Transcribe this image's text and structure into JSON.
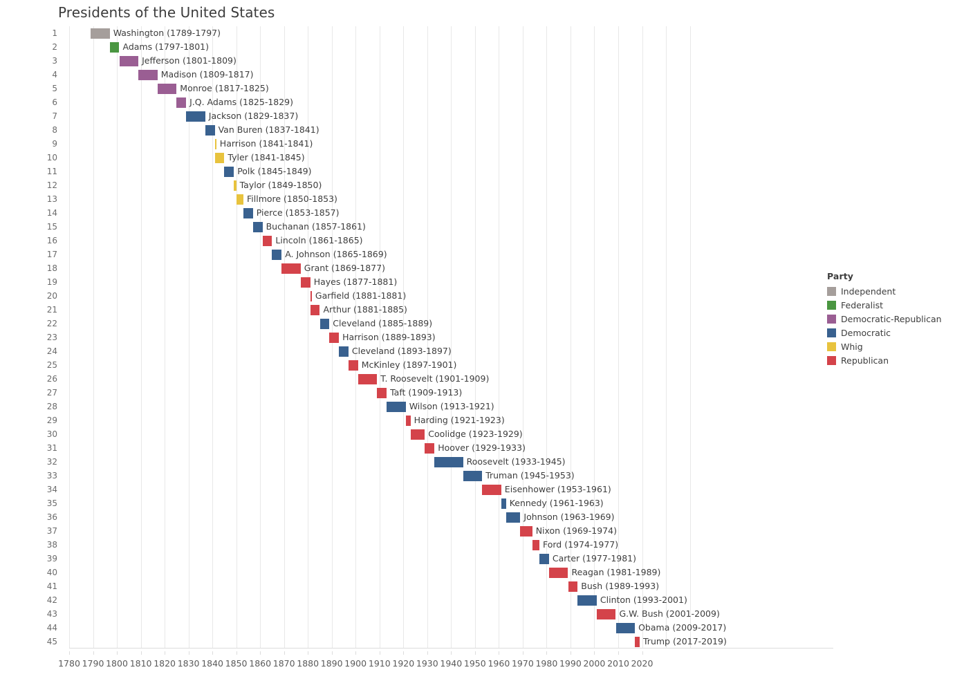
{
  "chart_data": {
    "type": "bar",
    "title": "Presidents of the United States",
    "subtitle": "",
    "xlabel": "",
    "ylabel": "",
    "orientation": "horizontal",
    "grid": true,
    "legend_position": "right",
    "xlim": [
      1780,
      2020
    ],
    "x_ticks": [
      1780,
      1790,
      1800,
      1810,
      1820,
      1830,
      1840,
      1850,
      1860,
      1870,
      1880,
      1890,
      1900,
      1910,
      1920,
      1930,
      1940,
      1950,
      1960,
      1970,
      1980,
      1990,
      2000,
      2010,
      2020
    ],
    "y_ticks": [
      1,
      2,
      3,
      4,
      5,
      6,
      7,
      8,
      9,
      10,
      11,
      12,
      13,
      14,
      15,
      16,
      17,
      18,
      19,
      20,
      21,
      22,
      23,
      24,
      25,
      26,
      27,
      28,
      29,
      30,
      31,
      32,
      33,
      34,
      35,
      36,
      37,
      38,
      39,
      40,
      41,
      42,
      43,
      44,
      45
    ],
    "legend": {
      "title": "Party",
      "entries": [
        {
          "label": "Independent",
          "color": "#a59e9b"
        },
        {
          "label": "Federalist",
          "color": "#4a9641"
        },
        {
          "label": "Democratic-Republican",
          "color": "#9a5e93"
        },
        {
          "label": "Democratic",
          "color": "#39618f"
        },
        {
          "label": "Whig",
          "color": "#e8c33e"
        },
        {
          "label": "Republican",
          "color": "#d4434a"
        }
      ]
    },
    "party_colors": {
      "Independent": "#a59e9b",
      "Federalist": "#4a9641",
      "Democratic-Republican": "#9a5e93",
      "Democratic": "#39618f",
      "Whig": "#e8c33e",
      "Republican": "#d4434a"
    },
    "bars": [
      {
        "num": 1,
        "name": "Washington",
        "start": 1789,
        "end": 1797,
        "party": "Independent",
        "label": "Washington (1789-1797)"
      },
      {
        "num": 2,
        "name": "Adams",
        "start": 1797,
        "end": 1801,
        "party": "Federalist",
        "label": "Adams (1797-1801)"
      },
      {
        "num": 3,
        "name": "Jefferson",
        "start": 1801,
        "end": 1809,
        "party": "Democratic-Republican",
        "label": "Jefferson (1801-1809)"
      },
      {
        "num": 4,
        "name": "Madison",
        "start": 1809,
        "end": 1817,
        "party": "Democratic-Republican",
        "label": "Madison (1809-1817)"
      },
      {
        "num": 5,
        "name": "Monroe",
        "start": 1817,
        "end": 1825,
        "party": "Democratic-Republican",
        "label": "Monroe (1817-1825)"
      },
      {
        "num": 6,
        "name": "J.Q. Adams",
        "start": 1825,
        "end": 1829,
        "party": "Democratic-Republican",
        "label": "J.Q. Adams (1825-1829)"
      },
      {
        "num": 7,
        "name": "Jackson",
        "start": 1829,
        "end": 1837,
        "party": "Democratic",
        "label": "Jackson (1829-1837)"
      },
      {
        "num": 8,
        "name": "Van Buren",
        "start": 1837,
        "end": 1841,
        "party": "Democratic",
        "label": "Van Buren (1837-1841)"
      },
      {
        "num": 9,
        "name": "Harrison",
        "start": 1841,
        "end": 1841,
        "party": "Whig",
        "label": "Harrison (1841-1841)"
      },
      {
        "num": 10,
        "name": "Tyler",
        "start": 1841,
        "end": 1845,
        "party": "Whig",
        "label": "Tyler (1841-1845)"
      },
      {
        "num": 11,
        "name": "Polk",
        "start": 1845,
        "end": 1849,
        "party": "Democratic",
        "label": "Polk (1845-1849)"
      },
      {
        "num": 12,
        "name": "Taylor",
        "start": 1849,
        "end": 1850,
        "party": "Whig",
        "label": "Taylor (1849-1850)"
      },
      {
        "num": 13,
        "name": "Fillmore",
        "start": 1850,
        "end": 1853,
        "party": "Whig",
        "label": "Fillmore (1850-1853)"
      },
      {
        "num": 14,
        "name": "Pierce",
        "start": 1853,
        "end": 1857,
        "party": "Democratic",
        "label": "Pierce (1853-1857)"
      },
      {
        "num": 15,
        "name": "Buchanan",
        "start": 1857,
        "end": 1861,
        "party": "Democratic",
        "label": "Buchanan (1857-1861)"
      },
      {
        "num": 16,
        "name": "Lincoln",
        "start": 1861,
        "end": 1865,
        "party": "Republican",
        "label": "Lincoln (1861-1865)"
      },
      {
        "num": 17,
        "name": "A. Johnson",
        "start": 1865,
        "end": 1869,
        "party": "Democratic",
        "label": "A. Johnson (1865-1869)"
      },
      {
        "num": 18,
        "name": "Grant",
        "start": 1869,
        "end": 1877,
        "party": "Republican",
        "label": "Grant (1869-1877)"
      },
      {
        "num": 19,
        "name": "Hayes",
        "start": 1877,
        "end": 1881,
        "party": "Republican",
        "label": "Hayes (1877-1881)"
      },
      {
        "num": 20,
        "name": "Garfield",
        "start": 1881,
        "end": 1881,
        "party": "Republican",
        "label": "Garfield (1881-1881)"
      },
      {
        "num": 21,
        "name": "Arthur",
        "start": 1881,
        "end": 1885,
        "party": "Republican",
        "label": "Arthur (1881-1885)"
      },
      {
        "num": 22,
        "name": "Cleveland",
        "start": 1885,
        "end": 1889,
        "party": "Democratic",
        "label": "Cleveland (1885-1889)"
      },
      {
        "num": 23,
        "name": "Harrison",
        "start": 1889,
        "end": 1893,
        "party": "Republican",
        "label": "Harrison (1889-1893)"
      },
      {
        "num": 24,
        "name": "Cleveland",
        "start": 1893,
        "end": 1897,
        "party": "Democratic",
        "label": "Cleveland (1893-1897)"
      },
      {
        "num": 25,
        "name": "McKinley",
        "start": 1897,
        "end": 1901,
        "party": "Republican",
        "label": "McKinley (1897-1901)"
      },
      {
        "num": 26,
        "name": "T. Roosevelt",
        "start": 1901,
        "end": 1909,
        "party": "Republican",
        "label": "T. Roosevelt (1901-1909)"
      },
      {
        "num": 27,
        "name": "Taft",
        "start": 1909,
        "end": 1913,
        "party": "Republican",
        "label": "Taft (1909-1913)"
      },
      {
        "num": 28,
        "name": "Wilson",
        "start": 1913,
        "end": 1921,
        "party": "Democratic",
        "label": "Wilson (1913-1921)"
      },
      {
        "num": 29,
        "name": "Harding",
        "start": 1921,
        "end": 1923,
        "party": "Republican",
        "label": "Harding (1921-1923)"
      },
      {
        "num": 30,
        "name": "Coolidge",
        "start": 1923,
        "end": 1929,
        "party": "Republican",
        "label": "Coolidge (1923-1929)"
      },
      {
        "num": 31,
        "name": "Hoover",
        "start": 1929,
        "end": 1933,
        "party": "Republican",
        "label": "Hoover (1929-1933)"
      },
      {
        "num": 32,
        "name": "Roosevelt",
        "start": 1933,
        "end": 1945,
        "party": "Democratic",
        "label": "Roosevelt (1933-1945)"
      },
      {
        "num": 33,
        "name": "Truman",
        "start": 1945,
        "end": 1953,
        "party": "Democratic",
        "label": "Truman (1945-1953)"
      },
      {
        "num": 34,
        "name": "Eisenhower",
        "start": 1953,
        "end": 1961,
        "party": "Republican",
        "label": "Eisenhower (1953-1961)"
      },
      {
        "num": 35,
        "name": "Kennedy",
        "start": 1961,
        "end": 1963,
        "party": "Democratic",
        "label": "Kennedy (1961-1963)"
      },
      {
        "num": 36,
        "name": "Johnson",
        "start": 1963,
        "end": 1969,
        "party": "Democratic",
        "label": "Johnson (1963-1969)"
      },
      {
        "num": 37,
        "name": "Nixon",
        "start": 1969,
        "end": 1974,
        "party": "Republican",
        "label": "Nixon (1969-1974)"
      },
      {
        "num": 38,
        "name": "Ford",
        "start": 1974,
        "end": 1977,
        "party": "Republican",
        "label": "Ford (1974-1977)"
      },
      {
        "num": 39,
        "name": "Carter",
        "start": 1977,
        "end": 1981,
        "party": "Democratic",
        "label": "Carter (1977-1981)"
      },
      {
        "num": 40,
        "name": "Reagan",
        "start": 1981,
        "end": 1989,
        "party": "Republican",
        "label": "Reagan (1981-1989)"
      },
      {
        "num": 41,
        "name": "Bush",
        "start": 1989,
        "end": 1993,
        "party": "Republican",
        "label": "Bush (1989-1993)"
      },
      {
        "num": 42,
        "name": "Clinton",
        "start": 1993,
        "end": 2001,
        "party": "Democratic",
        "label": "Clinton (1993-2001)"
      },
      {
        "num": 43,
        "name": "G.W. Bush",
        "start": 2001,
        "end": 2009,
        "party": "Republican",
        "label": "G.W. Bush (2001-2009)"
      },
      {
        "num": 44,
        "name": "Obama",
        "start": 2009,
        "end": 2017,
        "party": "Democratic",
        "label": "Obama (2009-2017)"
      },
      {
        "num": 45,
        "name": "Trump",
        "start": 2017,
        "end": 2019,
        "party": "Republican",
        "label": "Trump (2017-2019)"
      }
    ]
  }
}
